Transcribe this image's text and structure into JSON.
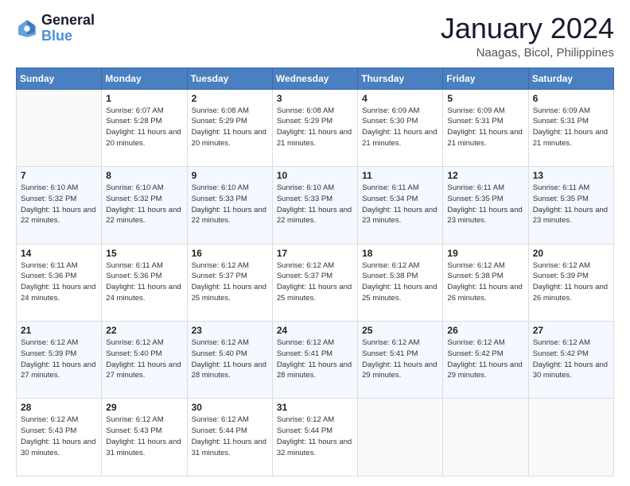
{
  "header": {
    "logo_line1": "General",
    "logo_line2": "Blue",
    "main_title": "January 2024",
    "subtitle": "Naagas, Bicol, Philippines"
  },
  "days_of_week": [
    "Sunday",
    "Monday",
    "Tuesday",
    "Wednesday",
    "Thursday",
    "Friday",
    "Saturday"
  ],
  "weeks": [
    [
      {
        "day": "",
        "sunrise": "",
        "sunset": "",
        "daylight": ""
      },
      {
        "day": "1",
        "sunrise": "Sunrise: 6:07 AM",
        "sunset": "Sunset: 5:28 PM",
        "daylight": "Daylight: 11 hours and 20 minutes."
      },
      {
        "day": "2",
        "sunrise": "Sunrise: 6:08 AM",
        "sunset": "Sunset: 5:29 PM",
        "daylight": "Daylight: 11 hours and 20 minutes."
      },
      {
        "day": "3",
        "sunrise": "Sunrise: 6:08 AM",
        "sunset": "Sunset: 5:29 PM",
        "daylight": "Daylight: 11 hours and 21 minutes."
      },
      {
        "day": "4",
        "sunrise": "Sunrise: 6:09 AM",
        "sunset": "Sunset: 5:30 PM",
        "daylight": "Daylight: 11 hours and 21 minutes."
      },
      {
        "day": "5",
        "sunrise": "Sunrise: 6:09 AM",
        "sunset": "Sunset: 5:31 PM",
        "daylight": "Daylight: 11 hours and 21 minutes."
      },
      {
        "day": "6",
        "sunrise": "Sunrise: 6:09 AM",
        "sunset": "Sunset: 5:31 PM",
        "daylight": "Daylight: 11 hours and 21 minutes."
      }
    ],
    [
      {
        "day": "7",
        "sunrise": "Sunrise: 6:10 AM",
        "sunset": "Sunset: 5:32 PM",
        "daylight": "Daylight: 11 hours and 22 minutes."
      },
      {
        "day": "8",
        "sunrise": "Sunrise: 6:10 AM",
        "sunset": "Sunset: 5:32 PM",
        "daylight": "Daylight: 11 hours and 22 minutes."
      },
      {
        "day": "9",
        "sunrise": "Sunrise: 6:10 AM",
        "sunset": "Sunset: 5:33 PM",
        "daylight": "Daylight: 11 hours and 22 minutes."
      },
      {
        "day": "10",
        "sunrise": "Sunrise: 6:10 AM",
        "sunset": "Sunset: 5:33 PM",
        "daylight": "Daylight: 11 hours and 22 minutes."
      },
      {
        "day": "11",
        "sunrise": "Sunrise: 6:11 AM",
        "sunset": "Sunset: 5:34 PM",
        "daylight": "Daylight: 11 hours and 23 minutes."
      },
      {
        "day": "12",
        "sunrise": "Sunrise: 6:11 AM",
        "sunset": "Sunset: 5:35 PM",
        "daylight": "Daylight: 11 hours and 23 minutes."
      },
      {
        "day": "13",
        "sunrise": "Sunrise: 6:11 AM",
        "sunset": "Sunset: 5:35 PM",
        "daylight": "Daylight: 11 hours and 23 minutes."
      }
    ],
    [
      {
        "day": "14",
        "sunrise": "Sunrise: 6:11 AM",
        "sunset": "Sunset: 5:36 PM",
        "daylight": "Daylight: 11 hours and 24 minutes."
      },
      {
        "day": "15",
        "sunrise": "Sunrise: 6:11 AM",
        "sunset": "Sunset: 5:36 PM",
        "daylight": "Daylight: 11 hours and 24 minutes."
      },
      {
        "day": "16",
        "sunrise": "Sunrise: 6:12 AM",
        "sunset": "Sunset: 5:37 PM",
        "daylight": "Daylight: 11 hours and 25 minutes."
      },
      {
        "day": "17",
        "sunrise": "Sunrise: 6:12 AM",
        "sunset": "Sunset: 5:37 PM",
        "daylight": "Daylight: 11 hours and 25 minutes."
      },
      {
        "day": "18",
        "sunrise": "Sunrise: 6:12 AM",
        "sunset": "Sunset: 5:38 PM",
        "daylight": "Daylight: 11 hours and 25 minutes."
      },
      {
        "day": "19",
        "sunrise": "Sunrise: 6:12 AM",
        "sunset": "Sunset: 5:38 PM",
        "daylight": "Daylight: 11 hours and 26 minutes."
      },
      {
        "day": "20",
        "sunrise": "Sunrise: 6:12 AM",
        "sunset": "Sunset: 5:39 PM",
        "daylight": "Daylight: 11 hours and 26 minutes."
      }
    ],
    [
      {
        "day": "21",
        "sunrise": "Sunrise: 6:12 AM",
        "sunset": "Sunset: 5:39 PM",
        "daylight": "Daylight: 11 hours and 27 minutes."
      },
      {
        "day": "22",
        "sunrise": "Sunrise: 6:12 AM",
        "sunset": "Sunset: 5:40 PM",
        "daylight": "Daylight: 11 hours and 27 minutes."
      },
      {
        "day": "23",
        "sunrise": "Sunrise: 6:12 AM",
        "sunset": "Sunset: 5:40 PM",
        "daylight": "Daylight: 11 hours and 28 minutes."
      },
      {
        "day": "24",
        "sunrise": "Sunrise: 6:12 AM",
        "sunset": "Sunset: 5:41 PM",
        "daylight": "Daylight: 11 hours and 28 minutes."
      },
      {
        "day": "25",
        "sunrise": "Sunrise: 6:12 AM",
        "sunset": "Sunset: 5:41 PM",
        "daylight": "Daylight: 11 hours and 29 minutes."
      },
      {
        "day": "26",
        "sunrise": "Sunrise: 6:12 AM",
        "sunset": "Sunset: 5:42 PM",
        "daylight": "Daylight: 11 hours and 29 minutes."
      },
      {
        "day": "27",
        "sunrise": "Sunrise: 6:12 AM",
        "sunset": "Sunset: 5:42 PM",
        "daylight": "Daylight: 11 hours and 30 minutes."
      }
    ],
    [
      {
        "day": "28",
        "sunrise": "Sunrise: 6:12 AM",
        "sunset": "Sunset: 5:43 PM",
        "daylight": "Daylight: 11 hours and 30 minutes."
      },
      {
        "day": "29",
        "sunrise": "Sunrise: 6:12 AM",
        "sunset": "Sunset: 5:43 PM",
        "daylight": "Daylight: 11 hours and 31 minutes."
      },
      {
        "day": "30",
        "sunrise": "Sunrise: 6:12 AM",
        "sunset": "Sunset: 5:44 PM",
        "daylight": "Daylight: 11 hours and 31 minutes."
      },
      {
        "day": "31",
        "sunrise": "Sunrise: 6:12 AM",
        "sunset": "Sunset: 5:44 PM",
        "daylight": "Daylight: 11 hours and 32 minutes."
      },
      {
        "day": "",
        "sunrise": "",
        "sunset": "",
        "daylight": ""
      },
      {
        "day": "",
        "sunrise": "",
        "sunset": "",
        "daylight": ""
      },
      {
        "day": "",
        "sunrise": "",
        "sunset": "",
        "daylight": ""
      }
    ]
  ]
}
